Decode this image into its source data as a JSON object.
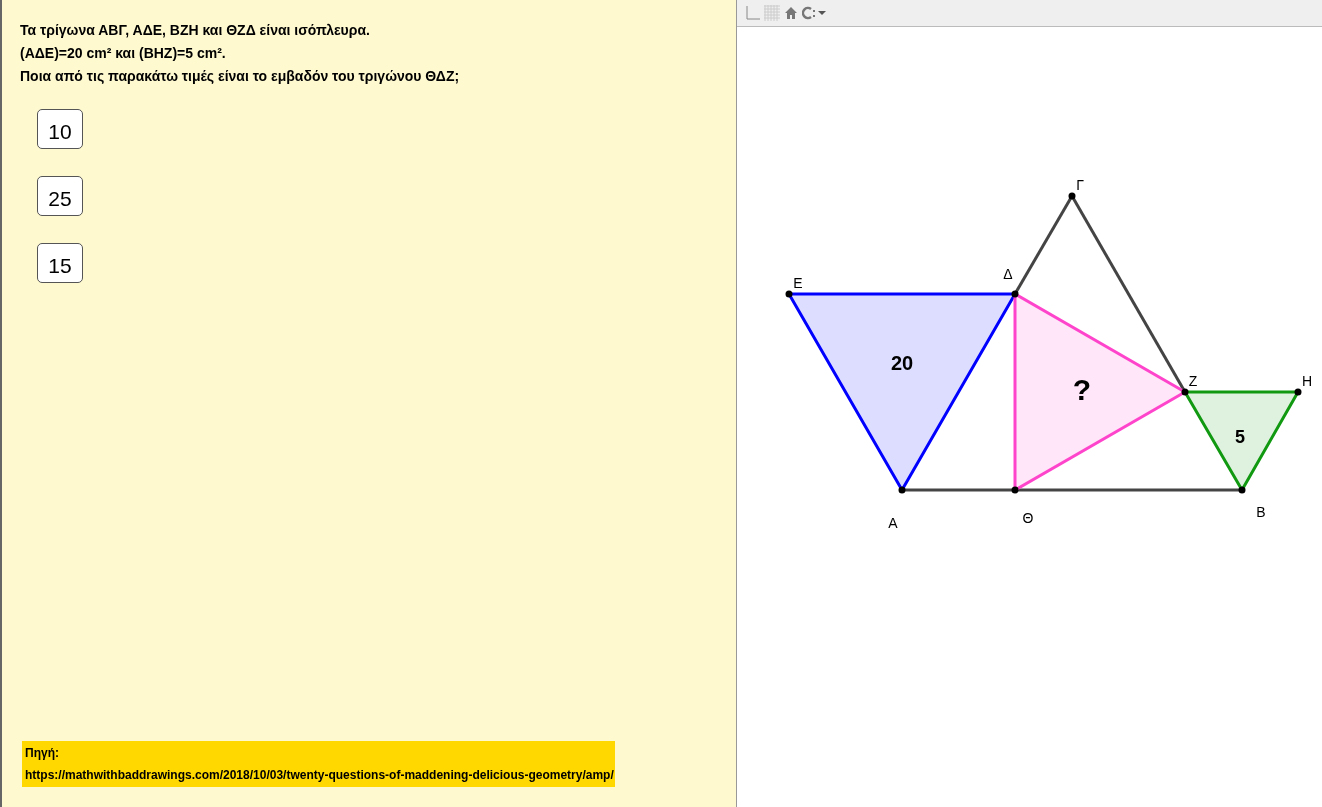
{
  "question": [
    "Τα τρίγωνα ΑΒΓ, ΑΔΕ, ΒΖΗ και ΘΖΔ είναι ισόπλευρα.",
    "(ΑΔΕ)=20 cm² και (ΒΗΖ)=5 cm².",
    "Ποια από τις παρακάτω τιμές είναι το εμβαδόν του τριγώνου ΘΔΖ;"
  ],
  "answers": [
    "10",
    "25",
    "15"
  ],
  "source": {
    "label": "Πηγή:",
    "url": "https://mathwithbaddrawings.com/2018/10/03/twenty-questions-of-maddening-delicious-geometry/amp/"
  },
  "drawing": {
    "triangles": [
      {
        "label": "20",
        "color": "#0000ff"
      },
      {
        "label": "?",
        "color": "#ff44cc"
      },
      {
        "label": "5",
        "color": "#119911"
      }
    ],
    "points": [
      "Γ",
      "Δ",
      "Ε",
      "Ζ",
      "Η",
      "Α",
      "Θ",
      "Β"
    ]
  }
}
